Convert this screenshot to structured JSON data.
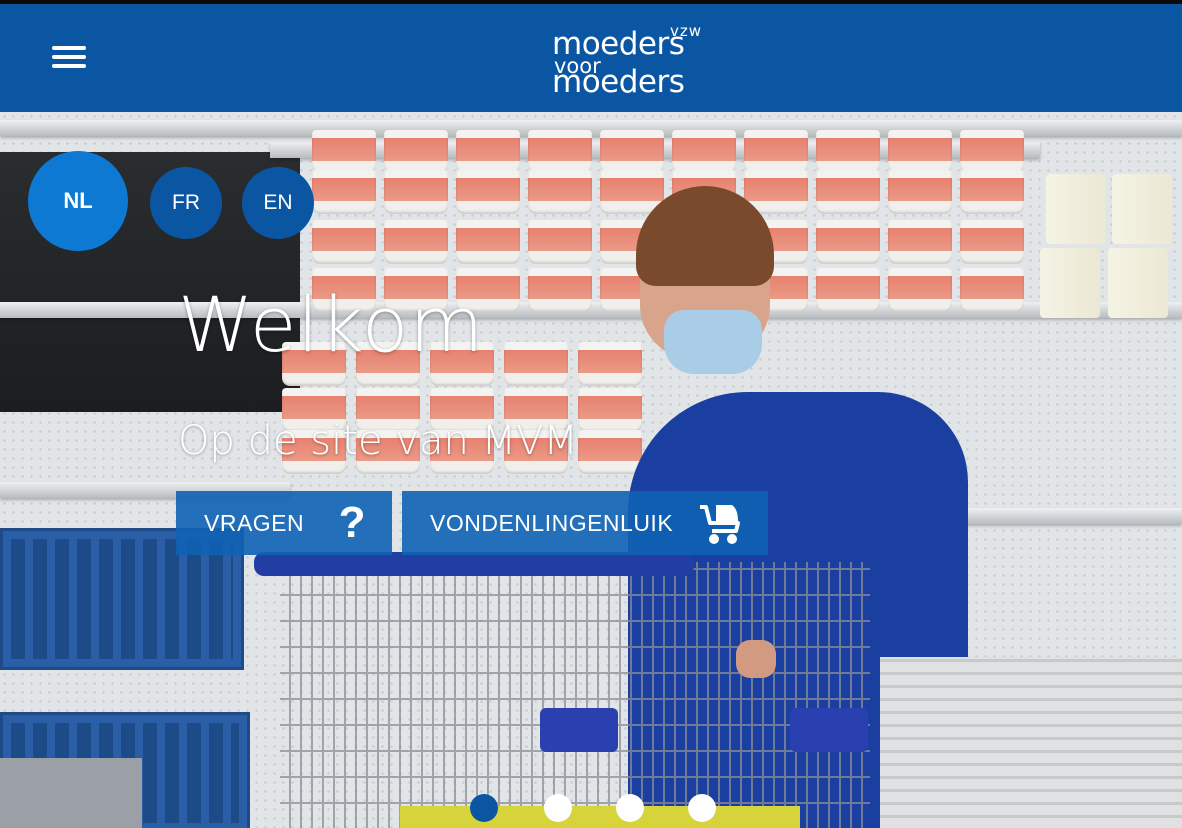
{
  "header": {
    "menu_icon": "hamburger-menu-icon",
    "logo": {
      "tag": "vzw",
      "line1": "moeders",
      "line2": "voor",
      "line3": "moeders"
    },
    "background_color": "#0b56a3"
  },
  "languages": [
    {
      "code": "NL",
      "active": true
    },
    {
      "code": "FR",
      "active": false
    },
    {
      "code": "EN",
      "active": false
    }
  ],
  "hero": {
    "title": "Welkom",
    "subtitle": "Op de site van MVM",
    "buttons": [
      {
        "label": "VRAGEN",
        "icon": "question-mark-icon"
      },
      {
        "label": "VONDENLINGENLUIK",
        "icon": "baby-carriage-icon"
      }
    ]
  },
  "carousel": {
    "slide_count": 4,
    "active_index": 0
  },
  "colors": {
    "brand_blue": "#0b56a3",
    "active_language": "#0d79d2"
  }
}
